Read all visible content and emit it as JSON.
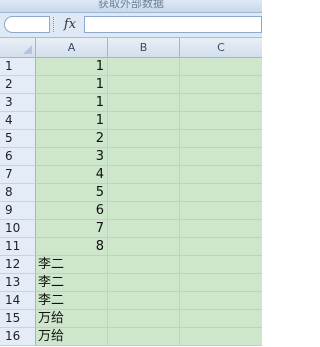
{
  "ribbon": {
    "partial_label": "获取外部数据"
  },
  "formula_bar": {
    "fx_label": "fx",
    "name_box_value": "",
    "formula_value": ""
  },
  "columns": [
    "A",
    "B",
    "C"
  ],
  "rows": [
    {
      "num": "1",
      "a": "1"
    },
    {
      "num": "2",
      "a": "1"
    },
    {
      "num": "3",
      "a": "1"
    },
    {
      "num": "4",
      "a": "1"
    },
    {
      "num": "5",
      "a": "2"
    },
    {
      "num": "6",
      "a": "3"
    },
    {
      "num": "7",
      "a": "4"
    },
    {
      "num": "8",
      "a": "5"
    },
    {
      "num": "9",
      "a": "6"
    },
    {
      "num": "10",
      "a": "7"
    },
    {
      "num": "11",
      "a": "8"
    },
    {
      "num": "12",
      "a": "李二"
    },
    {
      "num": "13",
      "a": "李二"
    },
    {
      "num": "14",
      "a": "李二"
    },
    {
      "num": "15",
      "a": "万给"
    },
    {
      "num": "16",
      "a": "万给"
    }
  ],
  "colors": {
    "selection_fill": "#cde6cc",
    "header_fill": "#e4ecf7",
    "ribbon_fill": "#dfe9f5"
  }
}
